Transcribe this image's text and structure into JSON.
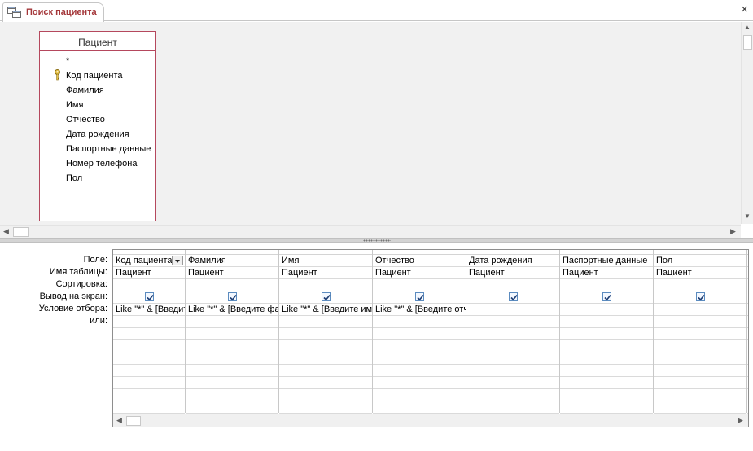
{
  "tab": {
    "title": "Поиск пациента"
  },
  "window": {
    "close_label": "×"
  },
  "table": {
    "name": "Пациент",
    "fields": [
      "*",
      "Код пациента",
      "Фамилия",
      "Имя",
      "Отчество",
      "Дата рождения",
      "Паспортные данные",
      "Номер телефона",
      "Пол"
    ]
  },
  "grid": {
    "row_labels": [
      "Поле:",
      "Имя таблицы:",
      "Сортировка:",
      "Вывод на экран:",
      "Условие отбора:",
      "или:"
    ],
    "columns": [
      {
        "field": "Код пациента",
        "table": "Пациент",
        "sort": "",
        "show": true,
        "criteria": "Like \"*\" & [Введите код пациента] & \"*\""
      },
      {
        "field": "Фамилия",
        "table": "Пациент",
        "sort": "",
        "show": true,
        "criteria": "Like \"*\" & [Введите фамилию] & \"*\""
      },
      {
        "field": "Имя",
        "table": "Пациент",
        "sort": "",
        "show": true,
        "criteria": "Like \"*\" & [Введите имя] & \"*\""
      },
      {
        "field": "Отчество",
        "table": "Пациент",
        "sort": "",
        "show": true,
        "criteria": "Like \"*\" & [Введите отчество] & \"*\""
      },
      {
        "field": "Дата рождения",
        "table": "Пациент",
        "sort": "",
        "show": true,
        "criteria": ""
      },
      {
        "field": "Паспортные данные",
        "table": "Пациент",
        "sort": "",
        "show": true,
        "criteria": ""
      },
      {
        "field": "Пол",
        "table": "Пациент",
        "sort": "",
        "show": true,
        "criteria": ""
      }
    ]
  },
  "icons": {
    "tab": "query-design-icon",
    "key": "primary-key-icon",
    "close": "close-icon"
  },
  "colors": {
    "tab_text": "#a4373a",
    "table_border": "#b5485d"
  }
}
